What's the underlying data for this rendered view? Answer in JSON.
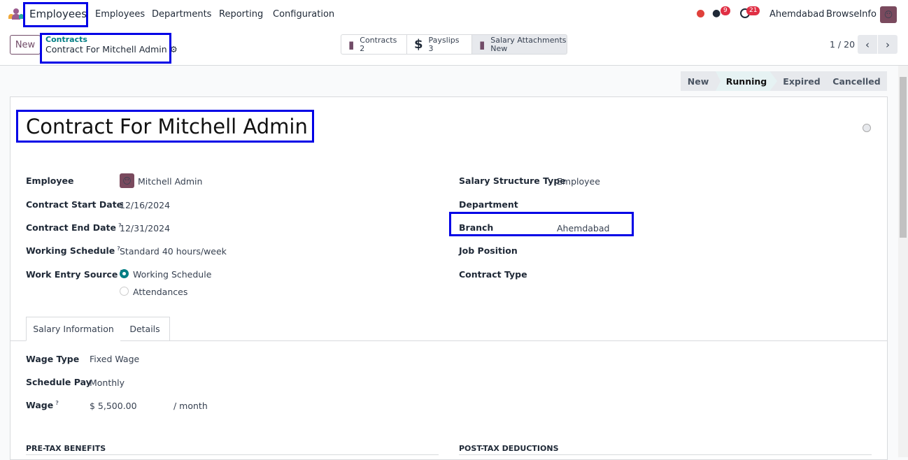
{
  "nav": {
    "app": "Employees",
    "menu": [
      "Employees",
      "Departments",
      "Reporting",
      "Configuration"
    ],
    "messages_count": "9",
    "activities_count": "21",
    "company": "Ahemdabad",
    "user": "BrowseInfo",
    "status_color": "#e0413b"
  },
  "control": {
    "new_label": "New",
    "breadcrumb_parent": "Contracts",
    "breadcrumb_current": "Contract For Mitchell Admin",
    "smart_buttons": [
      {
        "label": "Contracts",
        "value": "2"
      },
      {
        "label": "Payslips",
        "value": "3"
      },
      {
        "label": "Salary Attachments",
        "value": "New"
      }
    ],
    "pager": "1 / 20"
  },
  "statusbar": [
    "New",
    "Running",
    "Expired",
    "Cancelled"
  ],
  "form": {
    "title": "Contract For Mitchell Admin",
    "left": [
      {
        "label": "Employee",
        "value": "Mitchell Admin"
      },
      {
        "label": "Contract Start Date",
        "value": "12/16/2024"
      },
      {
        "label": "Contract End Date",
        "value": "12/31/2024"
      },
      {
        "label": "Working Schedule",
        "value": "Standard 40 hours/week"
      },
      {
        "label": "Work Entry Source",
        "options": [
          "Working Schedule",
          "Attendances"
        ]
      }
    ],
    "right": [
      {
        "label": "Salary Structure Type",
        "value": "Employee"
      },
      {
        "label": "Department",
        "value": ""
      },
      {
        "label": "Branch",
        "value": "Ahemdabad"
      },
      {
        "label": "Job Position",
        "value": ""
      },
      {
        "label": "Contract Type",
        "value": ""
      }
    ],
    "tabs": [
      "Salary Information",
      "Details"
    ],
    "salary": [
      {
        "label": "Wage Type",
        "value": "Fixed Wage"
      },
      {
        "label": "Schedule Pay",
        "value": "Monthly"
      },
      {
        "label": "Wage",
        "value": "$ 5,500.00",
        "unit": "/ month"
      }
    ],
    "sections": [
      "PRE-TAX BENEFITS",
      "POST-TAX DEDUCTIONS"
    ]
  }
}
